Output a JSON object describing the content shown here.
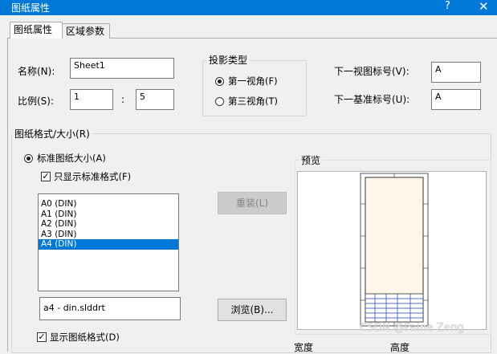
{
  "window": {
    "title": "图纸属性",
    "help_glyph": "?",
    "close_glyph": "✕"
  },
  "tabs": [
    {
      "label": "图纸属性"
    },
    {
      "label": "区域参数"
    }
  ],
  "sheet": {
    "name_label": "名称(N):",
    "name_value": "Sheet1",
    "scale_label": "比例(S):",
    "scale_left": "1",
    "scale_sep": ":",
    "scale_right": "5"
  },
  "projection": {
    "title": "投影类型",
    "first_angle": "第一视角(F)",
    "third_angle": "第三视角(T)",
    "selected": "first"
  },
  "labels": {
    "next_view_label": "下一视图标号(V):",
    "next_view_value": "A",
    "next_datum_label": "下一基准标号(U):",
    "next_datum_value": "A"
  },
  "format": {
    "group_title": "图纸格式/大小(R)",
    "standard_size": "标准图纸大小(A)",
    "only_standard": "只显示标准格式(F)",
    "sizes": [
      "A0 (DIN)",
      "A1 (DIN)",
      "A2 (DIN)",
      "A3 (DIN)",
      "A4 (DIN)"
    ],
    "selected_size": "A4 (DIN)",
    "reload_button": "重装(L)",
    "file_path": "a4 - din.slddrt",
    "browse_button": "浏览(B)...",
    "show_format": "显示图纸格式(D)"
  },
  "preview": {
    "title": "预览"
  },
  "bottom": {
    "width_label": "宽度",
    "height_label": "高度"
  },
  "watermark": "CSDN @Paine Zeng"
}
